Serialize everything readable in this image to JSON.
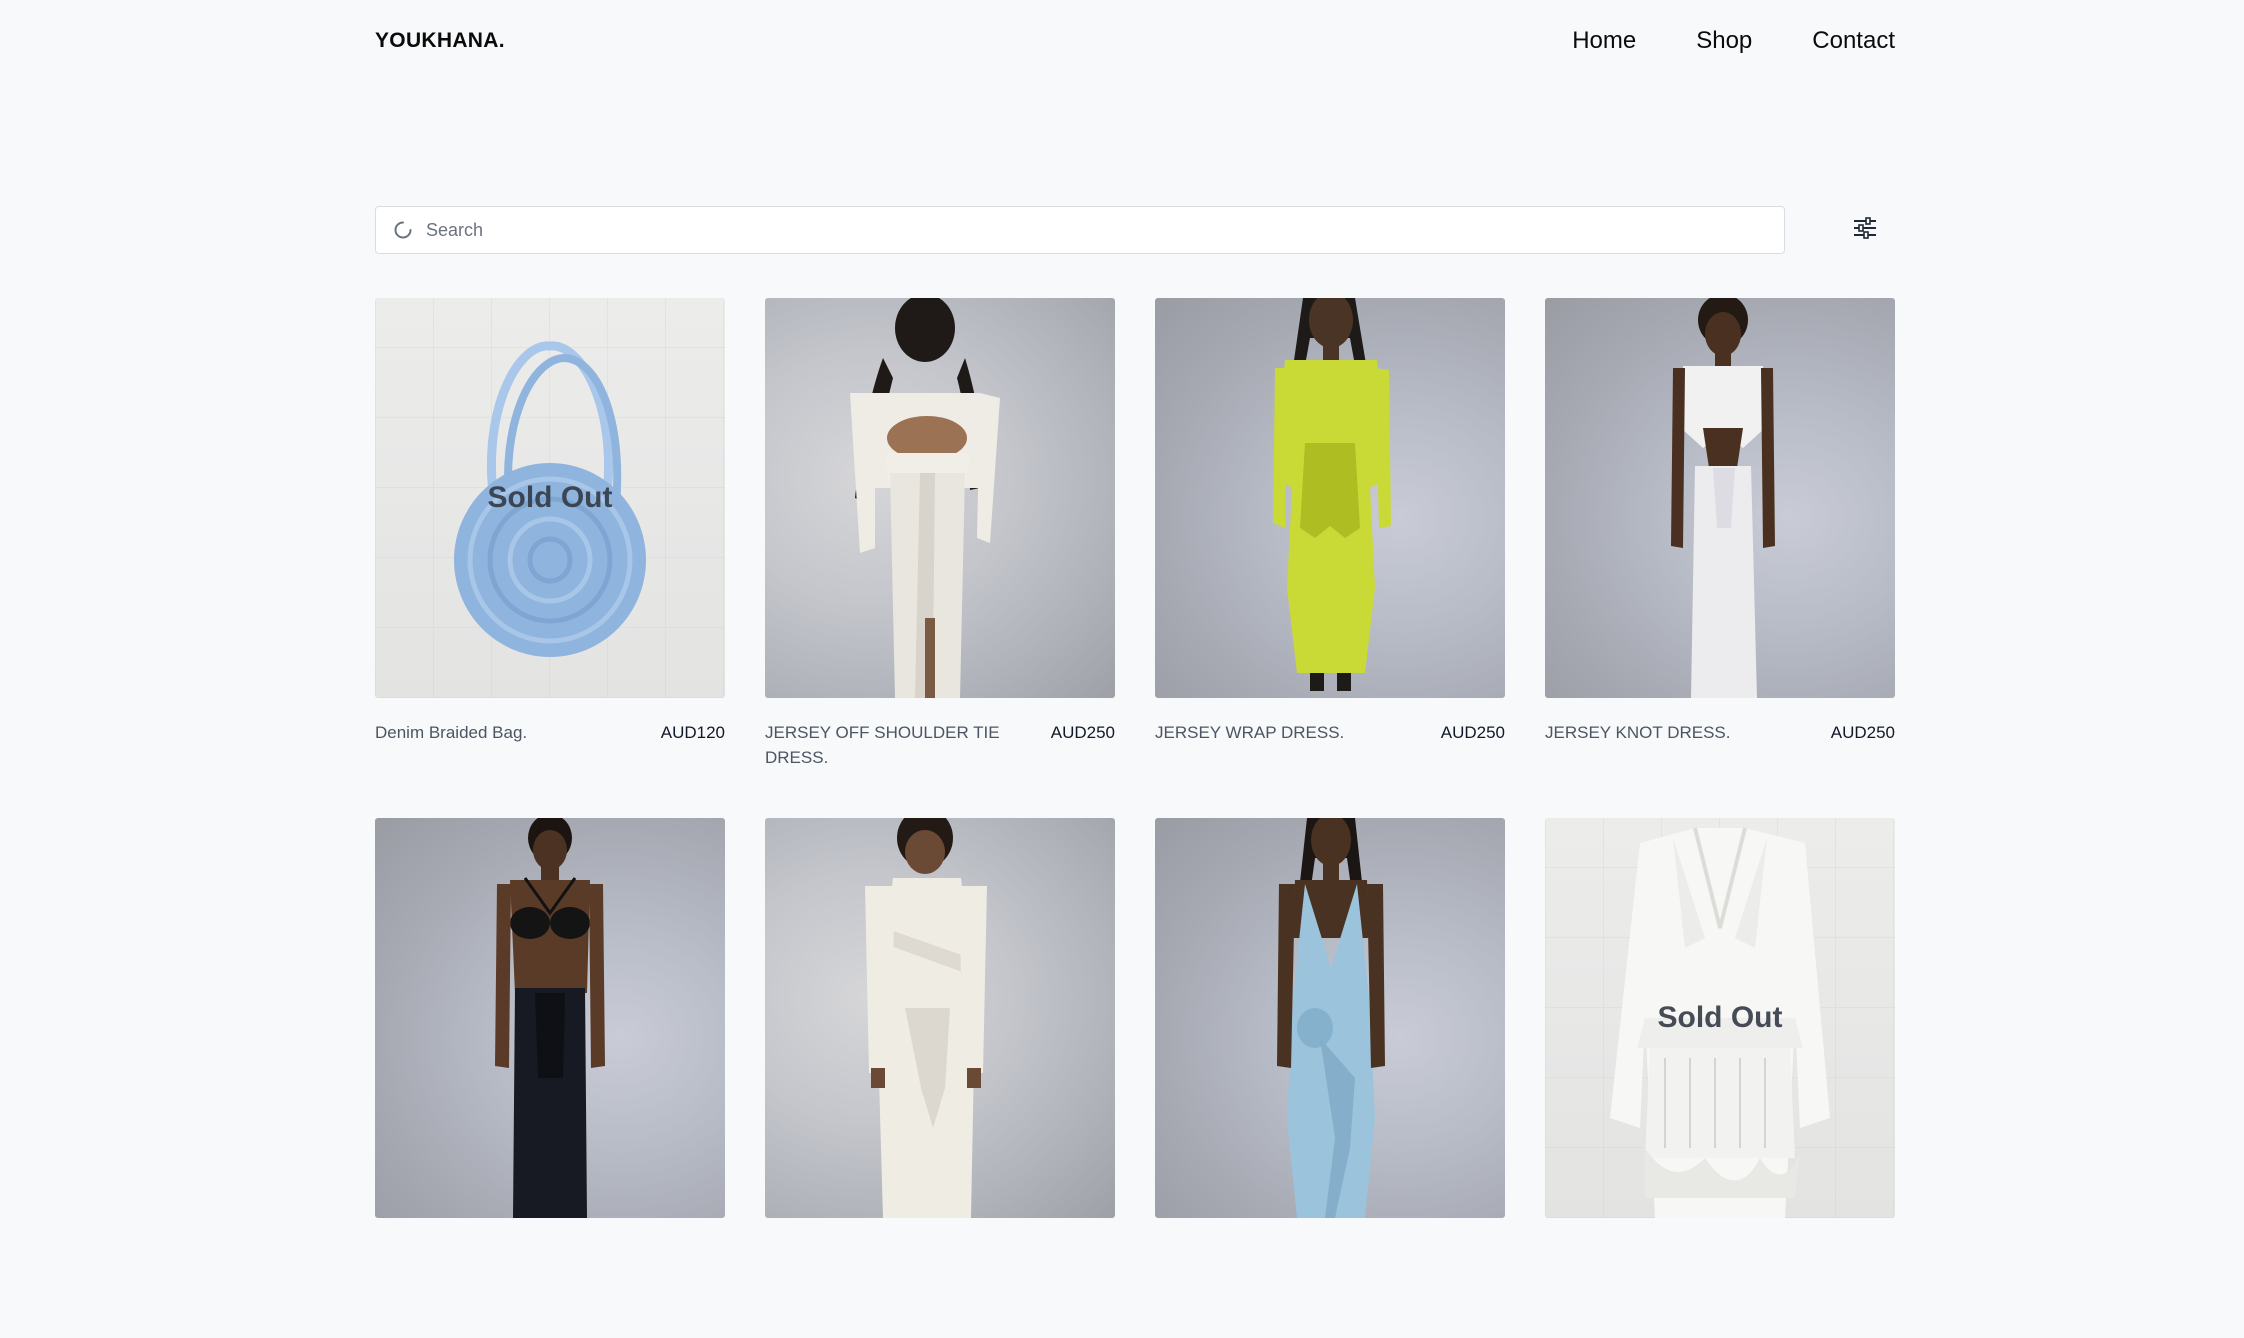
{
  "header": {
    "logo": "YOUKHANA.",
    "nav": [
      {
        "label": "Home"
      },
      {
        "label": "Shop"
      },
      {
        "label": "Contact"
      }
    ]
  },
  "search": {
    "placeholder": "Search",
    "value": ""
  },
  "icons": {
    "search": "loading-spinner-icon",
    "filter": "sliders-icon"
  },
  "products": [
    {
      "name": "Denim Braided Bag.",
      "price": "AUD120",
      "badge": "Sold Out"
    },
    {
      "name": "JERSEY OFF SHOULDER TIE DRESS.",
      "price": "AUD250",
      "badge": ""
    },
    {
      "name": "JERSEY WRAP DRESS.",
      "price": "AUD250",
      "badge": ""
    },
    {
      "name": "JERSEY KNOT DRESS.",
      "price": "AUD250",
      "badge": ""
    },
    {
      "name": "",
      "price": "",
      "badge": ""
    },
    {
      "name": "",
      "price": "",
      "badge": ""
    },
    {
      "name": "",
      "price": "",
      "badge": ""
    },
    {
      "name": "",
      "price": "",
      "badge": "Sold Out"
    }
  ],
  "colors": {
    "background": "#f8f9fa",
    "text": "#111827",
    "muted": "#4b5563",
    "denim": "#8fb4de",
    "lime": "#c9d935",
    "ice_blue": "#9cc3dc"
  }
}
